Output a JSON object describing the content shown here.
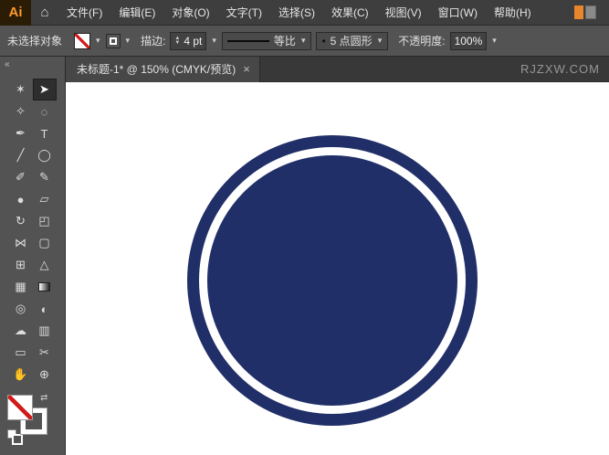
{
  "app": {
    "logo": "Ai",
    "watermark": "RJZXW.COM"
  },
  "icons": {
    "home": "⌂",
    "chevron_down": "▾",
    "up": "▲",
    "down": "▼",
    "close": "×",
    "collapse": "«",
    "swap": "⇄",
    "bullet": "•"
  },
  "menubar": {
    "items": [
      "文件(F)",
      "编辑(E)",
      "对象(O)",
      "文字(T)",
      "选择(S)",
      "效果(C)",
      "视图(V)",
      "窗口(W)",
      "帮助(H)"
    ]
  },
  "controlbar": {
    "status": "未选择对象",
    "stroke_label": "描边:",
    "stroke_weight": "4 pt",
    "profile_label": "等比",
    "brush_label": "5 点圆形",
    "opacity_label": "不透明度:",
    "opacity_value": "100%"
  },
  "tabbar": {
    "title": "未标题-1* @ 150% (CMYK/预览)"
  },
  "toolbar": {
    "selected_tool": "direct-selection-tool",
    "tools": [
      {
        "name": "selection-tool",
        "glyph": "✶"
      },
      {
        "name": "direct-selection-tool",
        "glyph": "➤"
      },
      {
        "name": "magic-wand-tool",
        "glyph": "✧"
      },
      {
        "name": "lasso-tool",
        "glyph": "◌"
      },
      {
        "name": "pen-tool",
        "glyph": "✒"
      },
      {
        "name": "type-tool",
        "glyph": "T"
      },
      {
        "name": "line-segment-tool",
        "glyph": "╱"
      },
      {
        "name": "ellipse-tool",
        "glyph": "◯"
      },
      {
        "name": "paintbrush-tool",
        "glyph": "✐"
      },
      {
        "name": "pencil-tool",
        "glyph": "✎"
      },
      {
        "name": "blob-brush-tool",
        "glyph": "●"
      },
      {
        "name": "eraser-tool",
        "glyph": "▱"
      },
      {
        "name": "rotate-tool",
        "glyph": "↻"
      },
      {
        "name": "scale-tool",
        "glyph": "◰"
      },
      {
        "name": "width-tool",
        "glyph": "⋈"
      },
      {
        "name": "free-transform-tool",
        "glyph": "▢"
      },
      {
        "name": "shape-builder-tool",
        "glyph": "⊞"
      },
      {
        "name": "perspective-grid-tool",
        "glyph": "△"
      },
      {
        "name": "mesh-tool",
        "glyph": "▦"
      },
      {
        "name": "gradient-tool",
        "glyph": ""
      },
      {
        "name": "eyedropper-tool",
        "glyph": "◎"
      },
      {
        "name": "blend-tool",
        "glyph": "◐"
      },
      {
        "name": "symbol-sprayer-tool",
        "glyph": "☁"
      },
      {
        "name": "column-graph-tool",
        "glyph": "▥"
      },
      {
        "name": "artboard-tool",
        "glyph": "▭"
      },
      {
        "name": "slice-tool",
        "glyph": "✂"
      },
      {
        "name": "hand-tool",
        "glyph": "✋"
      },
      {
        "name": "zoom-tool",
        "glyph": "⊕"
      }
    ]
  },
  "canvas": {
    "circle_fill": "#212f68",
    "ring_color": "#ffffff"
  }
}
